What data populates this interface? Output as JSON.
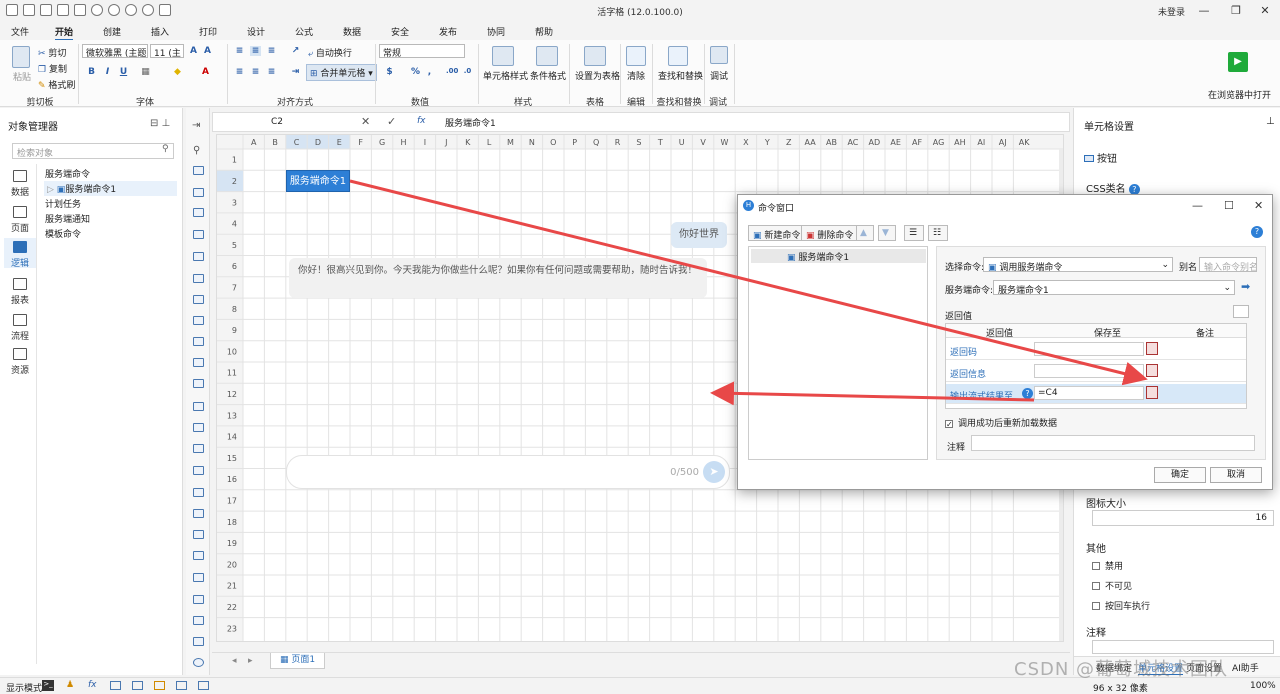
{
  "titlebar": {
    "app_title": "活字格 (12.0.100.0)",
    "login": "未登录"
  },
  "tabs": [
    "文件",
    "开始",
    "创建",
    "插入",
    "打印",
    "设计",
    "公式",
    "数据",
    "安全",
    "发布",
    "协同",
    "帮助"
  ],
  "active_tab": "开始",
  "ribbon": {
    "paste": "粘贴",
    "cut": "剪切",
    "copy": "复制",
    "format_painter": "格式刷",
    "clipboard_group": "剪切板",
    "font_name": "微软雅黑 (主题字",
    "font_size": "11 (主",
    "bold": "B",
    "italic": "I",
    "underline": "U",
    "font_group": "字体",
    "auto_wrap": "自动换行",
    "merge_cells": "合并单元格",
    "align_group": "对齐方式",
    "number_format": "常规",
    "currency": "$",
    "percent": "%",
    "comma": ",",
    "number_group": "数值",
    "cell_style": "单元格样式",
    "cond_format": "条件格式",
    "style_group": "样式",
    "set_table": "设置为表格",
    "table_group": "表格",
    "clear": "清除",
    "edit_group": "编辑",
    "find_replace": "查找和替换",
    "find_group": "查找和替换",
    "debug": "调试",
    "debug_group": "调试",
    "open_browser": "在浏览器中打开"
  },
  "left_panel": {
    "title": "对象管理器",
    "search_placeholder": "检索对象",
    "nav": [
      "数据",
      "页面",
      "逻辑",
      "报表",
      "流程",
      "资源"
    ],
    "active_nav": "逻辑",
    "tree": {
      "root": "服务端命令",
      "child": "服务端命令1",
      "items": [
        "计划任务",
        "服务端通知",
        "模板命令"
      ]
    }
  },
  "formula_bar": {
    "cell_ref": "C2",
    "fx": "fx",
    "value": "服务端命令1"
  },
  "grid": {
    "columns": [
      "A",
      "B",
      "C",
      "D",
      "E",
      "F",
      "G",
      "H",
      "I",
      "J",
      "K",
      "L",
      "M",
      "N",
      "O",
      "P",
      "Q",
      "R",
      "S",
      "T",
      "U",
      "V",
      "W",
      "X",
      "Y",
      "Z",
      "AA",
      "AB",
      "AC",
      "AD",
      "AE",
      "AF",
      "AG",
      "AH",
      "AI",
      "AJ",
      "AK"
    ],
    "rows": [
      "1",
      "2",
      "3",
      "4",
      "5",
      "6",
      "7",
      "8",
      "9",
      "10",
      "11",
      "12",
      "13",
      "14",
      "15",
      "16",
      "17",
      "18",
      "19",
      "20",
      "21",
      "22",
      "23"
    ]
  },
  "canvas": {
    "button_label": "服务端命令1",
    "user_message": "你好世界",
    "bot_message": "你好！很高兴见到你。今天我能为你做些什么呢？如果你有任何问题或需要帮助，随时告诉我！",
    "char_count": "0/500"
  },
  "sheet_tab": "页面1",
  "right_panel": {
    "title": "单元格设置",
    "cell_type": "按钮",
    "css_class": "CSS类名",
    "icon_size_label": "图标大小",
    "icon_size": "16",
    "other_label": "其他",
    "disabled": "禁用",
    "invisible": "不可见",
    "enter_exec": "按回车执行",
    "note_label": "注释",
    "bottom_tabs": [
      "数据绑定",
      "单元格设置",
      "页面设置",
      "AI助手"
    ]
  },
  "dialog": {
    "title": "命令窗口",
    "new_cmd": "新建命令",
    "del_cmd": "删除命令",
    "list_item": "服务端命令1",
    "select_cmd_label": "选择命令:",
    "select_cmd_value": "调用服务端命令",
    "alias_label": "别名",
    "alias_placeholder": "输入命令别名",
    "server_cmd_label": "服务端命令:",
    "server_cmd_value": "服务端命令1",
    "return_label": "返回值",
    "headers": [
      "返回值",
      "保存至",
      "备注"
    ],
    "rows": [
      {
        "name": "返回码",
        "value": ""
      },
      {
        "name": "返回信息",
        "value": ""
      },
      {
        "name": "输出流式结果至",
        "value": "=C4"
      }
    ],
    "reload_label": "调用成功后重新加载数据",
    "note_label": "注释",
    "ok": "确定",
    "cancel": "取消"
  },
  "statusbar": {
    "mode": "显示模式",
    "size": "96 x 32 像素",
    "zoom": "100%"
  },
  "watermark": "CSDN @葡萄城技术团队"
}
